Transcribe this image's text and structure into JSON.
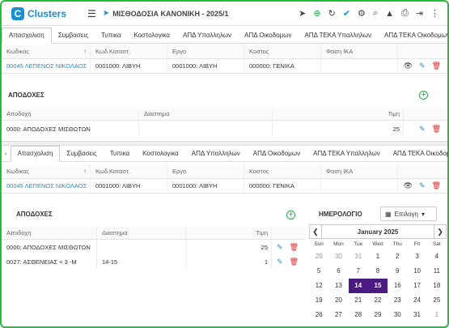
{
  "app": {
    "name": "Clusters",
    "title": "ΜΙΣΘΟΔΟΣΙΑ ΚΑΝΟΝΙΚΗ - 2025/1"
  },
  "tabs": [
    "Απασχολιση",
    "Συμβασεις",
    "Τυπικα",
    "Κοστολογικα",
    "ΑΠΔ Υπαλληλων",
    "ΑΠΔ Οικοδομων",
    "ΑΠΔ ΤΕΚΑ Υπαλληλων",
    "ΑΠΔ ΤΕΚΑ Οικοδομων"
  ],
  "grid": {
    "headers": [
      "Κωδικος",
      "Κωδ.Καταστ.",
      "Εργο",
      "Κοστος",
      "Φαση ΙΚΑ"
    ],
    "row": [
      "00045 ΛΕΠΕΝΟΣ ΝΙΚΟΛΑΟΣ",
      "0001000: ΛΙΒΥΗ",
      "0001000: ΛΙΒΥΗ",
      "000000: ΓΕΝΙΚΑ",
      ""
    ]
  },
  "apodoxes_top": {
    "title": "ΑΠΟΔΟΧΕΣ",
    "headers": [
      "Αποδοχη",
      "Διαστημα",
      "Τιμη"
    ],
    "rows": [
      {
        "name": "0000: ΑΠΟΔΟΧΕΣ ΜΙΣΘΩΤΩΝ",
        "interval": "",
        "value": "25"
      }
    ]
  },
  "apodoxes": {
    "title": "ΑΠΟΔΟΧΕΣ",
    "headers": [
      "Αποδοχη",
      "Διαστημα",
      "Τιμη"
    ],
    "rows": [
      {
        "name": "0000: ΑΠΟΔΟΧΕΣ ΜΙΣΘΩΤΩΝ",
        "interval": "",
        "value": "25"
      },
      {
        "name": "0027: ΑΣΘΕΝΕΙΑΣ < 3 -Μ",
        "interval": "14-15",
        "value": "1"
      }
    ]
  },
  "calendar": {
    "title": "ΗΜΕΡΟΛΟΓΙΟ",
    "select_label": "Επιλογη",
    "month": "January 2025",
    "day_headers": [
      "Sun",
      "Mon",
      "Tue",
      "Wed",
      "Thu",
      "Fri",
      "Sat"
    ],
    "days": [
      [
        "29",
        "30",
        "31",
        "1",
        "2",
        "3",
        "4"
      ],
      [
        "5",
        "6",
        "7",
        "8",
        "9",
        "10",
        "11"
      ],
      [
        "12",
        "13",
        "14",
        "15",
        "16",
        "17",
        "18"
      ],
      [
        "19",
        "20",
        "21",
        "22",
        "23",
        "24",
        "25"
      ],
      [
        "26",
        "27",
        "28",
        "29",
        "30",
        "31",
        "1"
      ]
    ],
    "selected": [
      "14",
      "15"
    ]
  },
  "colors": {
    "accent": "#1a8fd0",
    "selected": "#4b1a82",
    "border": "#1fbf3a"
  }
}
